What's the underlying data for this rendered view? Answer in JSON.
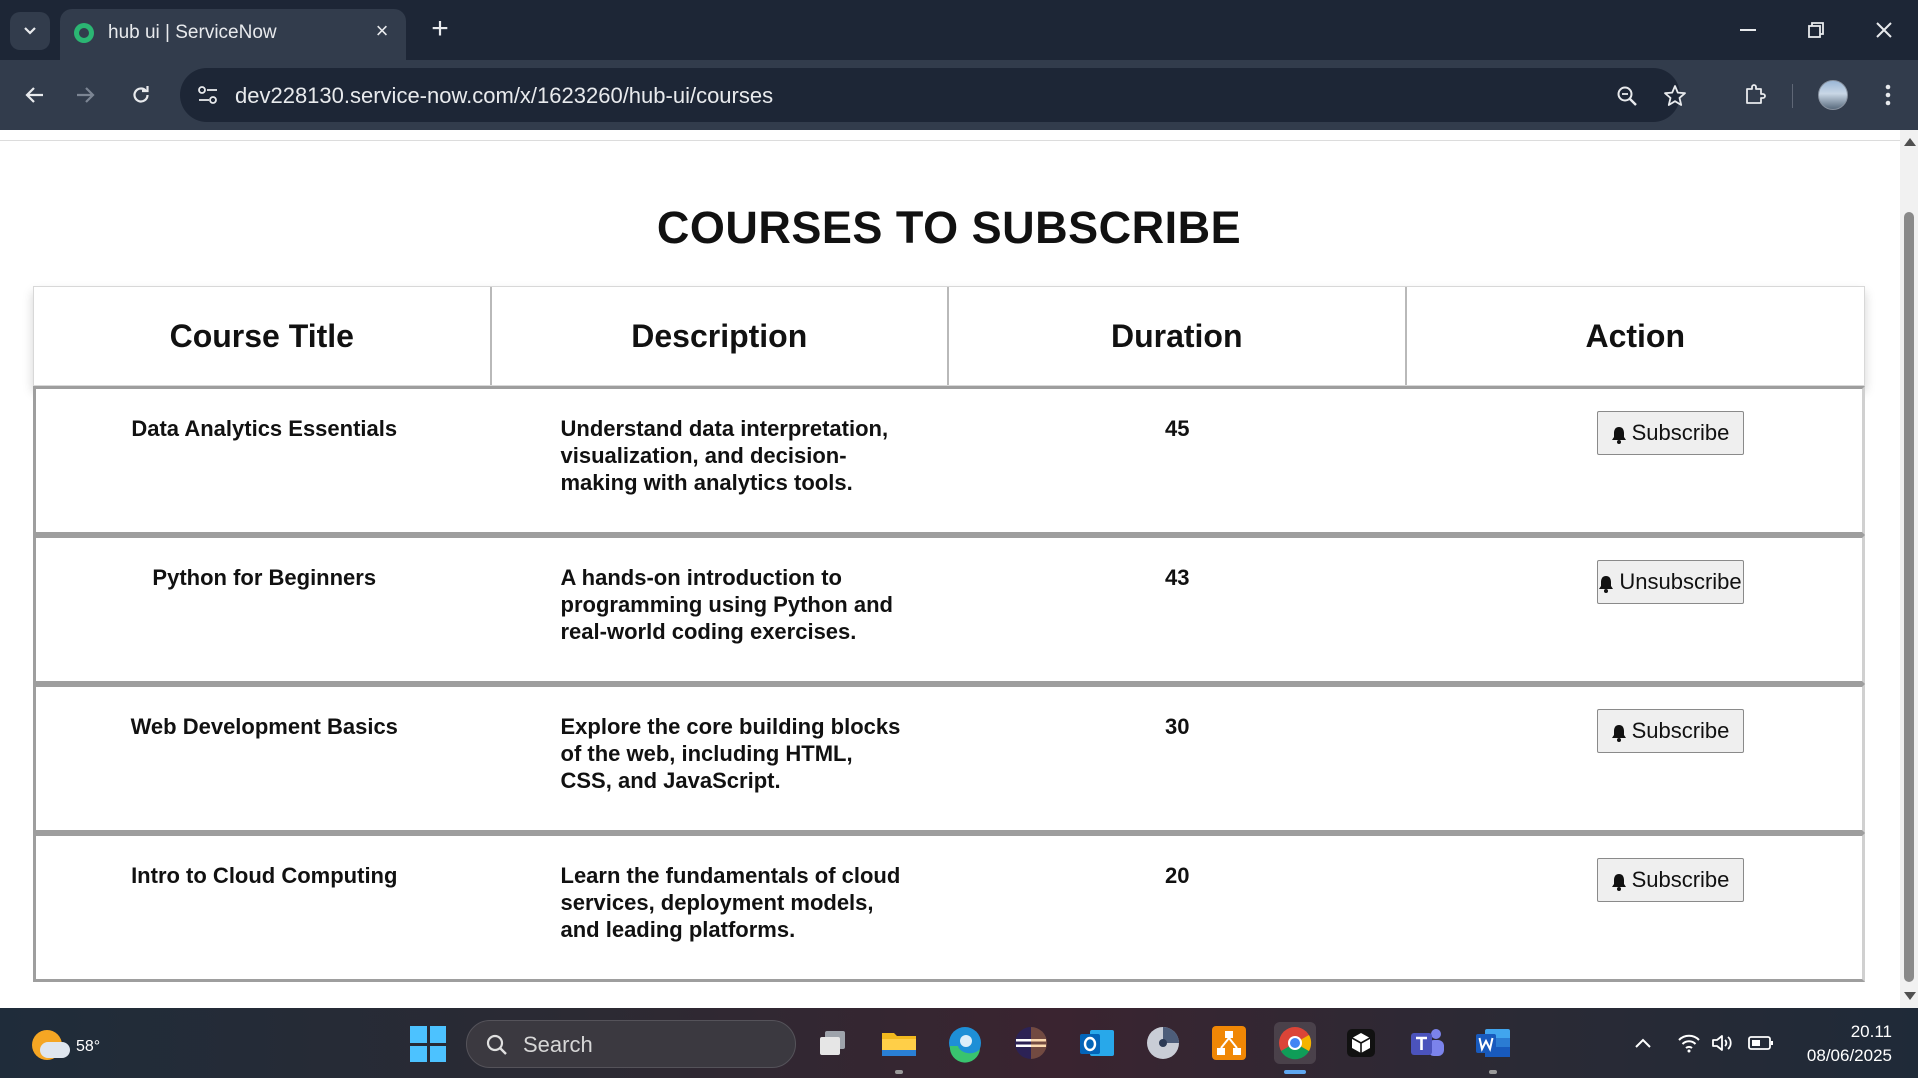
{
  "browser": {
    "tab_title": "hub ui | ServiceNow",
    "url": "dev228130.service-now.com/x/1623260/hub-ui/courses"
  },
  "page": {
    "title": "COURSES TO SUBSCRIBE",
    "columns": [
      "Course Title",
      "Description",
      "Duration",
      "Action"
    ],
    "courses": [
      {
        "title": "Data Analytics Essentials",
        "description": "Understand data interpretation, visualization, and decision-making with analytics tools.",
        "duration": "45",
        "action": "Subscribe"
      },
      {
        "title": "Python for Beginners",
        "description": "A hands-on introduction to programming using Python and real-world coding exercises.",
        "duration": "43",
        "action": "Unsubscribe"
      },
      {
        "title": "Web Development Basics",
        "description": "Explore the core building blocks of the web, including HTML, CSS, and JavaScript.",
        "duration": "30",
        "action": "Subscribe"
      },
      {
        "title": "Intro to Cloud Computing",
        "description": "Learn the fundamentals of cloud services, deployment models, and leading platforms.",
        "duration": "20",
        "action": "Subscribe"
      }
    ]
  },
  "taskbar": {
    "weather_temp": "58°",
    "search_placeholder": "Search",
    "time": "20.11",
    "date": "08/06/2025",
    "apps": [
      "task-view",
      "file-explorer",
      "edge",
      "eclipse",
      "outlook",
      "timer-app",
      "drawio",
      "chrome",
      "app-cube",
      "teams",
      "word"
    ]
  },
  "colors": {
    "chrome_dark": "#1d2636",
    "chrome_toolbar": "#323c4c",
    "row_border": "#9e9e9e",
    "button_bg": "#efefef",
    "servicenow_green": "#2bb673"
  }
}
